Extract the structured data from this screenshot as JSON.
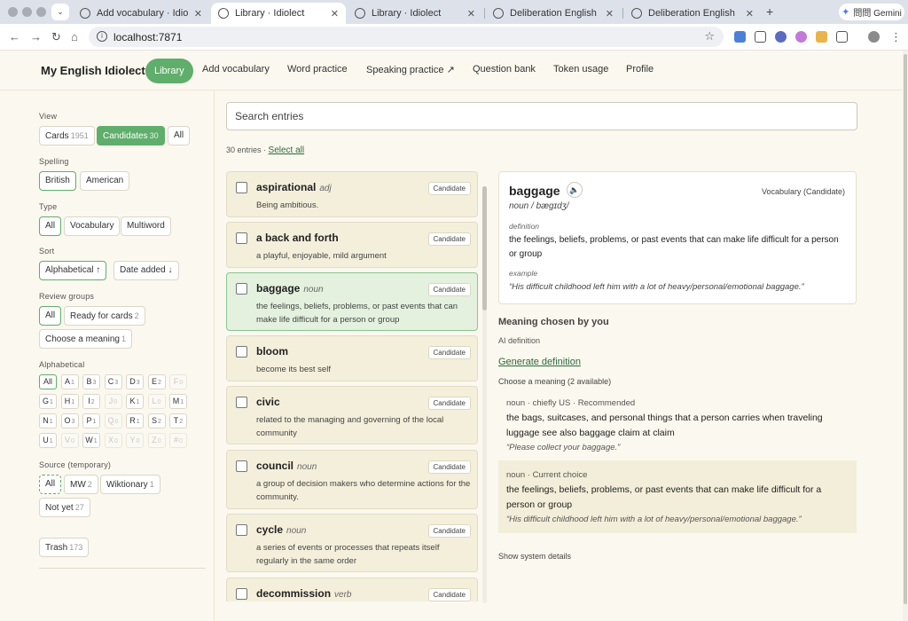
{
  "browser": {
    "tabs": [
      {
        "title": "Add vocabulary · Idiolect",
        "active": false
      },
      {
        "title": "Library · Idiolect",
        "active": true
      },
      {
        "title": "Library · Idiolect",
        "active": false
      },
      {
        "title": "Deliberation English",
        "active": false
      },
      {
        "title": "Deliberation English",
        "active": false
      }
    ],
    "url": "localhost:7871",
    "gemini_label": "問問 Gemini"
  },
  "nav": {
    "brand": "My English Idiolect",
    "items": [
      "Library",
      "Add vocabulary",
      "Word practice",
      "Speaking practice ↗",
      "Question bank",
      "Token usage",
      "Profile"
    ],
    "active": "Library"
  },
  "sidebar": {
    "view": {
      "label": "View",
      "options": [
        {
          "label": "Cards",
          "count": "1951"
        },
        {
          "label": "Candidates",
          "count": "30"
        },
        {
          "label": "All",
          "count": ""
        }
      ]
    },
    "spelling": {
      "label": "Spelling",
      "options": [
        "British",
        "American"
      ]
    },
    "type": {
      "label": "Type",
      "options": [
        "All",
        "Vocabulary",
        "Multiword"
      ]
    },
    "sort": {
      "label": "Sort",
      "options": [
        "Alphabetical ↑",
        "Date added ↓"
      ]
    },
    "review": {
      "label": "Review groups",
      "options": [
        {
          "label": "All",
          "count": ""
        },
        {
          "label": "Ready for cards",
          "count": "2"
        },
        {
          "label": "Choose a meaning",
          "count": "1"
        }
      ]
    },
    "alphabetical": {
      "label": "Alphabetical",
      "letters": [
        {
          "l": "All",
          "c": ""
        },
        {
          "l": "A",
          "c": "1"
        },
        {
          "l": "B",
          "c": "3"
        },
        {
          "l": "C",
          "c": "3"
        },
        {
          "l": "D",
          "c": "3"
        },
        {
          "l": "E",
          "c": "2"
        },
        {
          "l": "F",
          "c": "0"
        },
        {
          "l": "G",
          "c": "1"
        },
        {
          "l": "H",
          "c": "1"
        },
        {
          "l": "I",
          "c": "2"
        },
        {
          "l": "J",
          "c": "0"
        },
        {
          "l": "K",
          "c": "1"
        },
        {
          "l": "L",
          "c": "0"
        },
        {
          "l": "M",
          "c": "1"
        },
        {
          "l": "N",
          "c": "1"
        },
        {
          "l": "O",
          "c": "3"
        },
        {
          "l": "P",
          "c": "1"
        },
        {
          "l": "Q",
          "c": "0"
        },
        {
          "l": "R",
          "c": "1"
        },
        {
          "l": "S",
          "c": "2"
        },
        {
          "l": "T",
          "c": "2"
        },
        {
          "l": "U",
          "c": "1"
        },
        {
          "l": "V",
          "c": "0"
        },
        {
          "l": "W",
          "c": "1"
        },
        {
          "l": "X",
          "c": "0"
        },
        {
          "l": "Y",
          "c": "0"
        },
        {
          "l": "Z",
          "c": "0"
        },
        {
          "l": "#",
          "c": "0"
        }
      ]
    },
    "source": {
      "label": "Source (temporary)",
      "options": [
        {
          "label": "All",
          "count": ""
        },
        {
          "label": "MW",
          "count": "2"
        },
        {
          "label": "Wiktionary",
          "count": "1"
        },
        {
          "label": "Not yet",
          "count": "27"
        }
      ]
    },
    "trash": {
      "label": "Trash",
      "count": "173"
    }
  },
  "main": {
    "search_placeholder": "Search entries",
    "entries_count": "30 entries ·",
    "select_all": "Select all",
    "entries": [
      {
        "term": "aspirational",
        "pos": "adj",
        "status": "Candidate",
        "def": "Being ambitious.",
        "selected": false
      },
      {
        "term": "a back and forth",
        "pos": "",
        "status": "Candidate",
        "def": "a playful, enjoyable, mild argument",
        "selected": false
      },
      {
        "term": "baggage",
        "pos": "noun",
        "status": "Candidate",
        "def": "the feelings, beliefs, problems, or past events that can make life difficult for a person or group",
        "selected": true
      },
      {
        "term": "bloom",
        "pos": "",
        "status": "Candidate",
        "def": "become its best self",
        "selected": false
      },
      {
        "term": "civic",
        "pos": "",
        "status": "Candidate",
        "def": "related to the managing and governing of the local community",
        "selected": false
      },
      {
        "term": "council",
        "pos": "noun",
        "status": "Candidate",
        "def": "a group of decision makers who determine actions for the community.",
        "selected": false
      },
      {
        "term": "cycle",
        "pos": "noun",
        "status": "Candidate",
        "def": "a series of events or processes that repeats itself regularly in the same order",
        "selected": false
      },
      {
        "term": "decommission",
        "pos": "verb",
        "status": "Candidate",
        "def": "",
        "selected": false
      }
    ]
  },
  "detail": {
    "term": "baggage",
    "kind": "Vocabulary (Candidate)",
    "pron": "noun  / bægɪdʒ/",
    "definition_label": "definition",
    "definition": "the feelings, beliefs, problems, or past events that can make life difficult for a person or group",
    "example_label": "example",
    "example": "“His difficult childhood left him with a lot of heavy/personal/emotional baggage.”",
    "meaning_title": "Meaning chosen by you",
    "ai_label": "AI definition",
    "generate": "Generate definition",
    "choose": "Choose a meaning (2 available)",
    "meanings": [
      {
        "meta": "noun · chiefly US · Recommended",
        "text": "the bags, suitcases, and personal things that a person carries when traveling luggage see also baggage claim at claim",
        "example": "“Please collect your baggage.”"
      },
      {
        "meta": "noun · Current choice",
        "text": "the feelings, beliefs, problems, or past events that can make life difficult for a person or group",
        "example": "“His difficult childhood left him with a lot of heavy/personal/emotional baggage.”"
      }
    ],
    "system": "Show system details"
  }
}
